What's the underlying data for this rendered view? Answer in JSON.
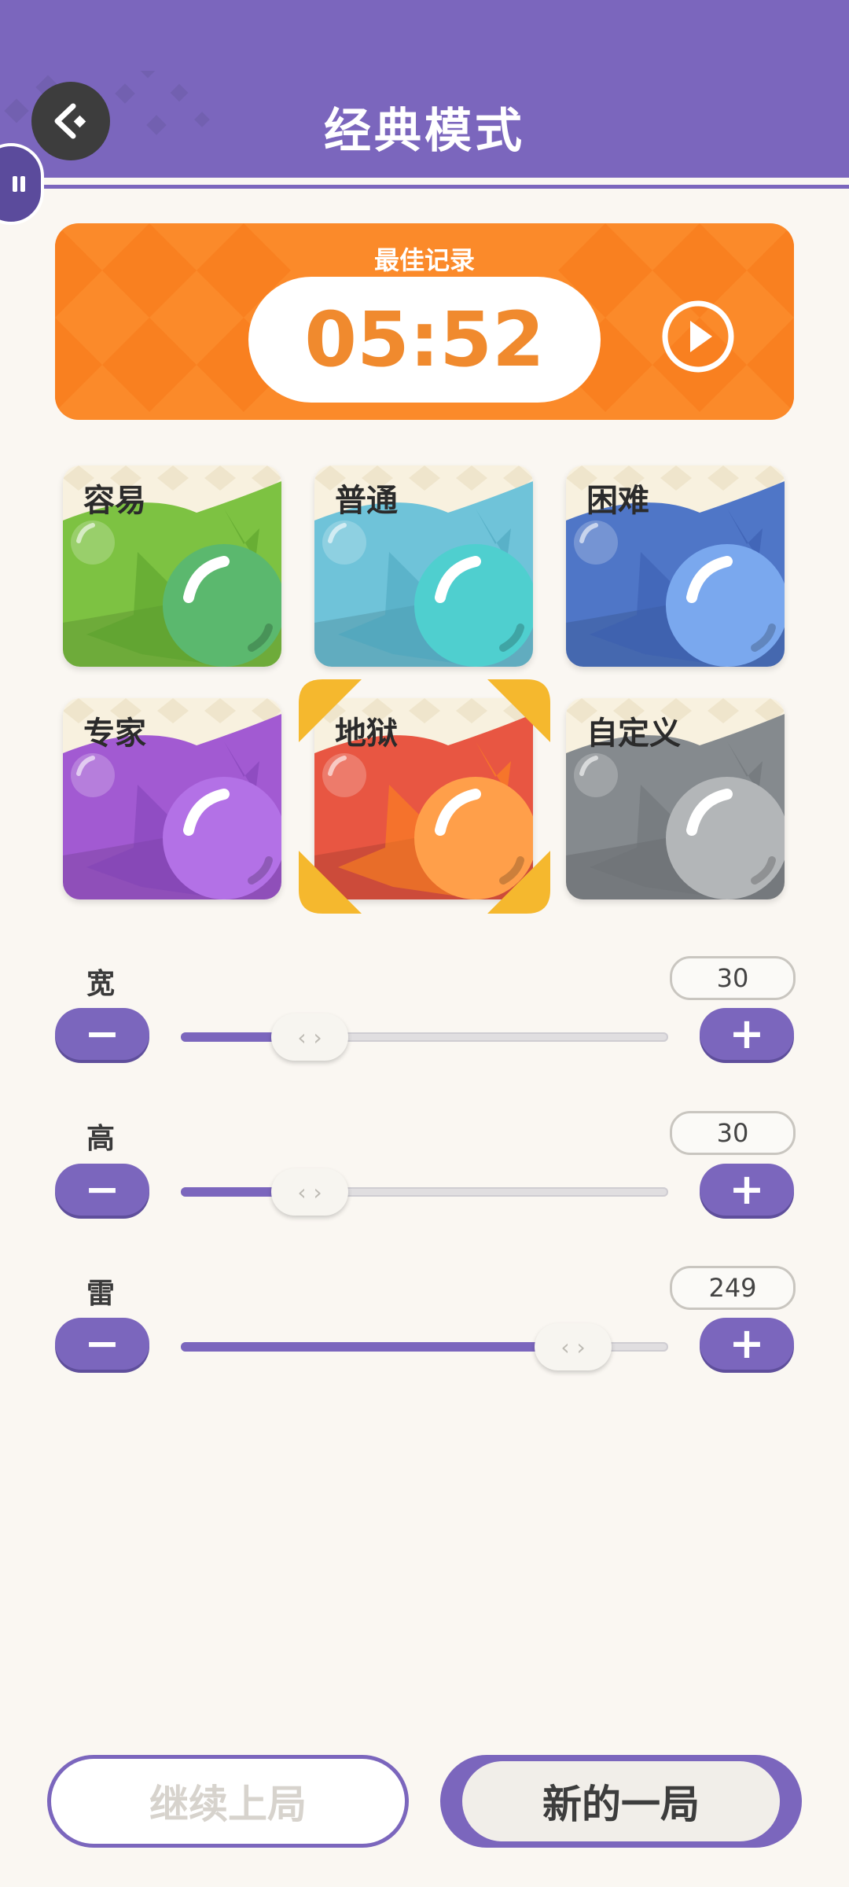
{
  "header": {
    "title": "经典模式",
    "color": "#7b66bd"
  },
  "best_record": {
    "label": "最佳记录",
    "time": "05:52",
    "color": "#fb8a2a"
  },
  "difficulties": [
    {
      "label": "容易",
      "color_base": "#7dc242",
      "color_dark": "#5aa02c",
      "color_ball": "#5bb86e"
    },
    {
      "label": "普通",
      "color_base": "#6fc3d9",
      "color_dark": "#4ba5bd",
      "color_ball": "#4fcfcf"
    },
    {
      "label": "困难",
      "color_base": "#4f76c7",
      "color_dark": "#3a5cae",
      "color_ball": "#7aa8ee"
    },
    {
      "label": "专家",
      "color_base": "#a25ad2",
      "color_dark": "#8243b6",
      "color_ball": "#b371e6"
    },
    {
      "label": "地狱",
      "color_base": "#e85642",
      "color_dark": "#ff8a1c",
      "color_ball": "#ff9f4a"
    },
    {
      "label": "自定义",
      "color_base": "#858a8e",
      "color_dark": "#6e7377",
      "color_ball": "#b3b6b8"
    }
  ],
  "selected_difficulty": "地狱",
  "params": {
    "width": {
      "label": "宽",
      "value": "30",
      "fraction": 0.24
    },
    "height": {
      "label": "高",
      "value": "30",
      "fraction": 0.24
    },
    "mines": {
      "label": "雷",
      "value": "249",
      "fraction": 0.78
    }
  },
  "controls": {
    "minus": "−",
    "plus": "+",
    "thumb": "‹ ›"
  },
  "buttons": {
    "continue": "继续上局",
    "new_game": "新的一局"
  }
}
